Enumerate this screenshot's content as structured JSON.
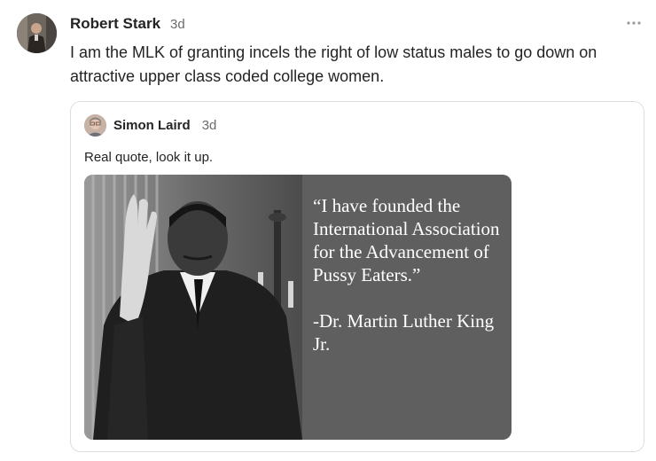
{
  "post": {
    "author": "Robert Stark",
    "time": "3d",
    "text": "I am the MLK of granting incels the right of low status males to go down on attractive upper class coded college women.",
    "more_icon": "more-horizontal-icon"
  },
  "quote": {
    "author": "Simon Laird",
    "time": "3d",
    "text": "Real quote, look it up.",
    "image": {
      "quote_text": "“I have founded the International Association for the Advancement of Pussy Eaters.”",
      "attribution": "-Dr. Martin Luther King Jr."
    }
  },
  "colors": {
    "text_primary": "#242424",
    "text_secondary": "#6b6b6b",
    "card_border": "#dedede",
    "image_panel": "#5f5f5f"
  }
}
